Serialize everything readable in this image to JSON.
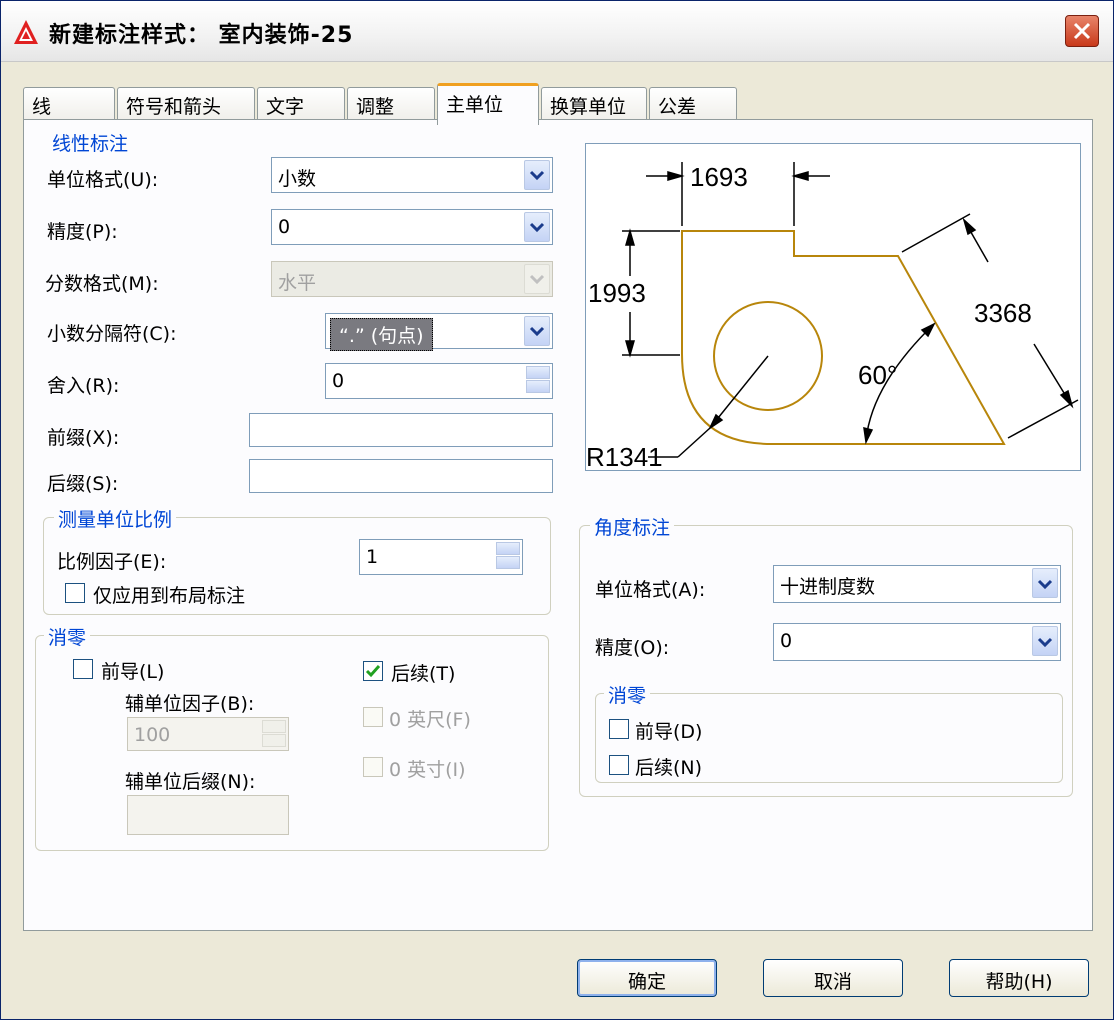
{
  "window": {
    "title": "新建标注样式： 室内装饰-25"
  },
  "tabs": [
    "线",
    "符号和箭头",
    "文字",
    "调整",
    "主单位",
    "换算单位",
    "公差"
  ],
  "linear": {
    "legend": "线性标注",
    "unit_format_label": "单位格式(U):",
    "unit_format_value": "小数",
    "precision_label": "精度(P):",
    "precision_value": "0",
    "fraction_label": "分数格式(M):",
    "fraction_value": "水平",
    "decimal_sep_label": "小数分隔符(C):",
    "decimal_sep_value": "“.” (句点)",
    "round_label": "舍入(R):",
    "round_value": "0",
    "prefix_label": "前缀(X):",
    "prefix_value": "",
    "suffix_label": "后缀(S):",
    "suffix_value": ""
  },
  "scale": {
    "legend": "测量单位比例",
    "factor_label": "比例因子(E):",
    "factor_value": "1",
    "layout_only_label": "仅应用到布局标注"
  },
  "zero": {
    "legend": "消零",
    "leading_label": "前导(L)",
    "trailing_label": "后续(T)",
    "sub_factor_label": "辅单位因子(B):",
    "sub_factor_value": "100",
    "sub_suffix_label": "辅单位后缀(N):",
    "sub_suffix_value": "",
    "feet_label": "0 英尺(F)",
    "inches_label": "0 英寸(I)"
  },
  "preview": {
    "dim_top": "1693",
    "dim_left": "1993",
    "dim_right": "3368",
    "dim_angle": "60°",
    "dim_radius": "R1341"
  },
  "angular": {
    "legend": "角度标注",
    "unit_format_label": "单位格式(A):",
    "unit_format_value": "十进制度数",
    "precision_label": "精度(O):",
    "precision_value": "0",
    "zero_legend": "消零",
    "leading_label": "前导(D)",
    "trailing_label": "后续(N)"
  },
  "buttons": {
    "ok": "确定",
    "cancel": "取消",
    "help": "帮助(H)"
  },
  "colors": {
    "accent": "#0046d5",
    "preview_shape": "#b8860b",
    "tab_active": "#f0a020"
  },
  "icons": {
    "app": "autocad-icon",
    "close": "close-icon"
  }
}
